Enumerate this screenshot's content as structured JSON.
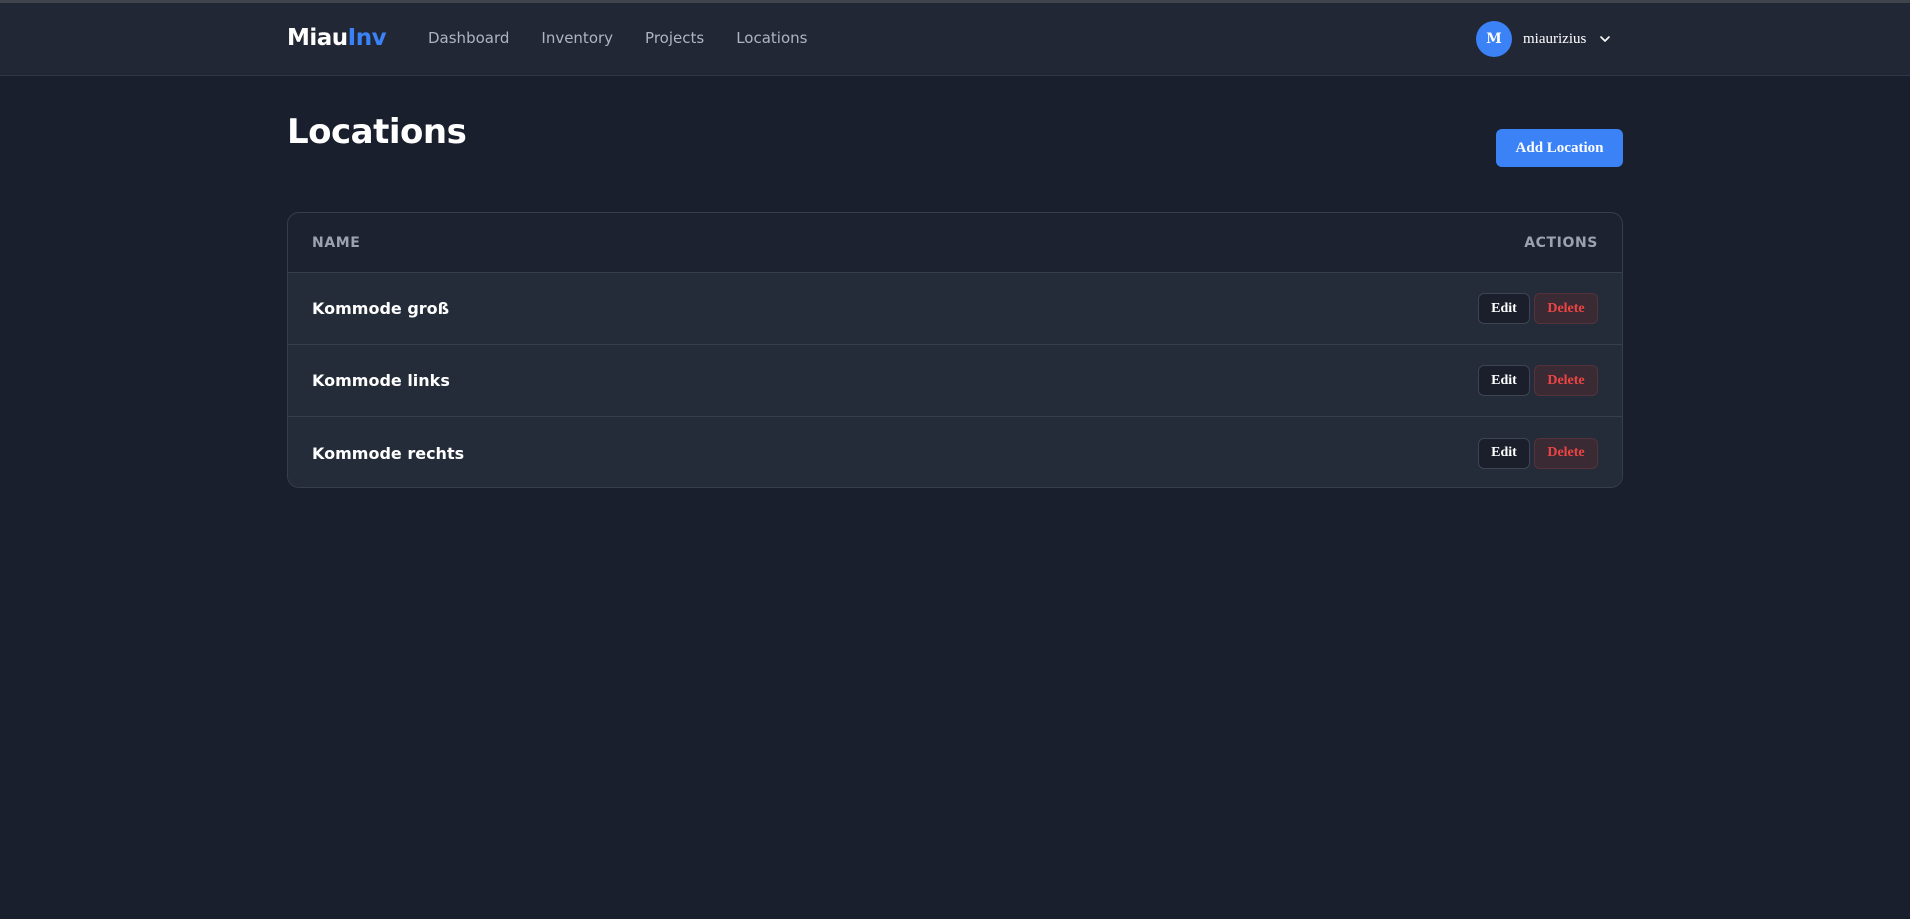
{
  "brand": {
    "part1": "Miau",
    "part2": "Inv"
  },
  "nav": {
    "items": [
      "Dashboard",
      "Inventory",
      "Projects",
      "Locations"
    ]
  },
  "user": {
    "initial": "M",
    "name": "miaurizius"
  },
  "page": {
    "title": "Locations",
    "add_button": "Add Location"
  },
  "table": {
    "columns": {
      "name": "NAME",
      "actions": "ACTIONS"
    },
    "rows": [
      {
        "name": "Kommode groß",
        "edit": "Edit",
        "delete": "Delete"
      },
      {
        "name": "Kommode links",
        "edit": "Edit",
        "delete": "Delete"
      },
      {
        "name": "Kommode rechts",
        "edit": "Edit",
        "delete": "Delete"
      }
    ]
  },
  "colors": {
    "background": "#1a1f2e",
    "navbar": "#212735",
    "accent": "#3b82f6",
    "danger": "#ef4444"
  }
}
